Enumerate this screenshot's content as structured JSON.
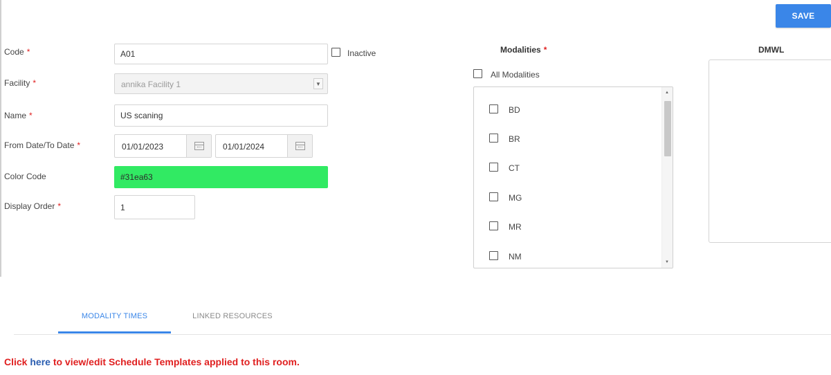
{
  "toolbar": {
    "save_label": "SAVE"
  },
  "form": {
    "code": {
      "label": "Code",
      "required": "*",
      "value": "A01"
    },
    "inactive": {
      "label": "Inactive"
    },
    "facility": {
      "label": "Facility",
      "required": "*",
      "value": "annika Facility 1"
    },
    "name": {
      "label": "Name",
      "required": "*",
      "value": "US scaning"
    },
    "dates": {
      "label": "From Date/To Date",
      "required": "*",
      "from": "01/01/2023",
      "to": "01/01/2024"
    },
    "color_code": {
      "label": "Color Code",
      "value": "#31ea63",
      "color": "#31ea63"
    },
    "display_order": {
      "label": "Display Order",
      "required": "*",
      "value": "1"
    }
  },
  "modalities": {
    "title": "Modalities",
    "required": "*",
    "all_label": "All Modalities",
    "items": [
      {
        "label": "BD"
      },
      {
        "label": "BR"
      },
      {
        "label": "CT"
      },
      {
        "label": "MG"
      },
      {
        "label": "MR"
      },
      {
        "label": "NM"
      }
    ]
  },
  "dmwl": {
    "title": "DMWL"
  },
  "tabs": [
    {
      "label": "MODALITY TIMES",
      "active": true
    },
    {
      "label": "LINKED RESOURCES",
      "active": false
    }
  ],
  "footer": {
    "prefix": "Click",
    "link": "here",
    "suffix": "to view/edit Schedule Templates applied to this room."
  },
  "colors": {
    "accent": "#3a86e8",
    "required": "#e02020",
    "link": "#2a5db0"
  }
}
